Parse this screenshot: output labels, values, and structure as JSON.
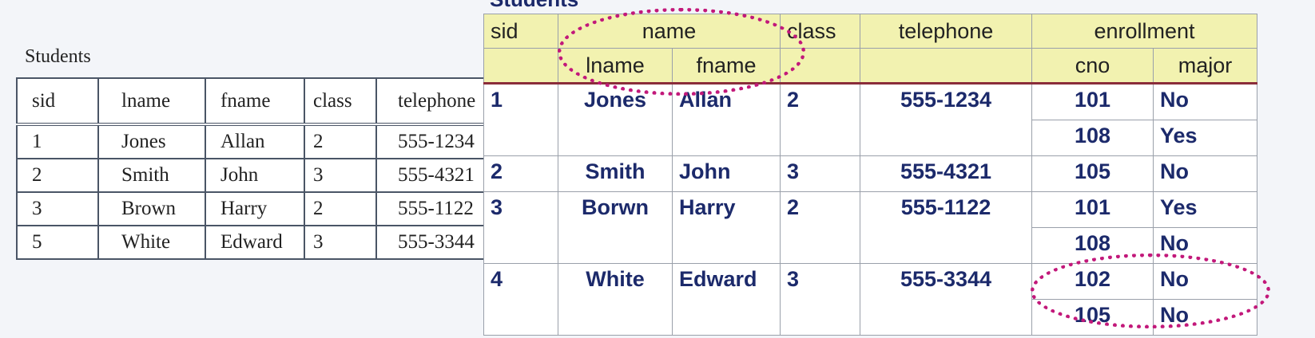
{
  "left": {
    "caption": "Students",
    "headers": [
      "sid",
      "lname",
      "fname",
      "class",
      "telephone"
    ],
    "rows": [
      [
        "1",
        "Jones",
        "Allan",
        "2",
        "555-1234"
      ],
      [
        "2",
        "Smith",
        "John",
        "3",
        "555-4321"
      ],
      [
        "3",
        "Brown",
        "Harry",
        "2",
        "555-1122"
      ],
      [
        "5",
        "White",
        "Edward",
        "3",
        "555-3344"
      ]
    ]
  },
  "right": {
    "caption": "Students",
    "headers": {
      "sid": "sid",
      "name": "name",
      "class": "class",
      "telephone": "telephone",
      "enrollment": "enrollment",
      "lname": "lname",
      "fname": "fname",
      "cno": "cno",
      "major": "major"
    },
    "rows": [
      [
        "1",
        "Jones",
        "Allan",
        "2",
        "555-1234",
        "101",
        "No"
      ],
      [
        "108",
        "Yes"
      ],
      [
        "2",
        "Smith",
        "John",
        "3",
        "555-4321",
        "105",
        "No"
      ],
      [
        "3",
        "Borwn",
        "Harry",
        "2",
        "555-1122",
        "101",
        "Yes"
      ],
      [
        "108",
        "No"
      ],
      [
        "4",
        "White",
        "Edward",
        "3",
        "555-3344",
        "102",
        "No"
      ],
      [
        "105",
        "No"
      ]
    ]
  },
  "colors": {
    "header_fill": "#f2f2b0",
    "text_blue": "#1c2a6b",
    "highlight": "#c2187a"
  }
}
